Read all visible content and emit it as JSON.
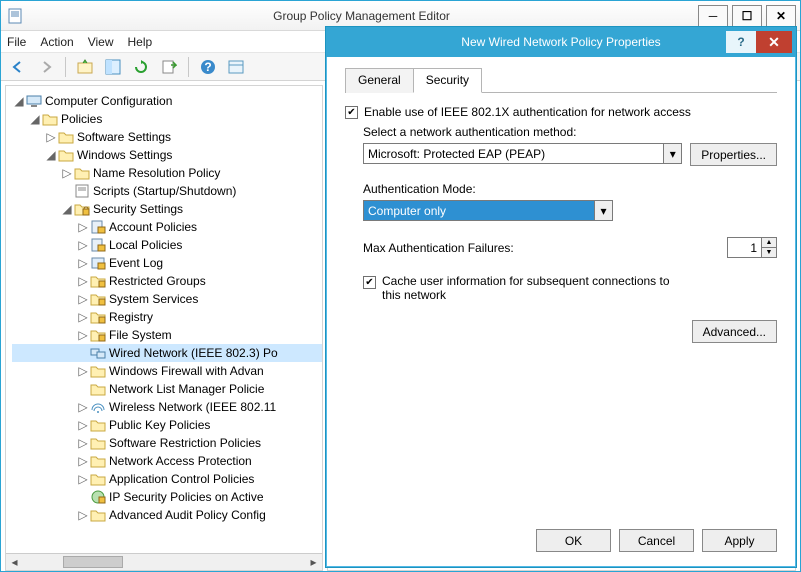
{
  "window": {
    "title": "Group Policy Management Editor"
  },
  "menu": {
    "file": "File",
    "action": "Action",
    "view": "View",
    "help": "Help"
  },
  "tree": {
    "root": "Computer Configuration",
    "policies": "Policies",
    "software": "Software Settings",
    "windows": "Windows Settings",
    "nrp": "Name Resolution Policy",
    "scripts": "Scripts (Startup/Shutdown)",
    "security": "Security Settings",
    "nodes": {
      "account": "Account Policies",
      "local": "Local Policies",
      "eventlog": "Event Log",
      "restricted": "Restricted Groups",
      "system": "System Services",
      "registry": "Registry",
      "file": "File System",
      "wired": "Wired Network (IEEE 802.3) Po",
      "firewall": "Windows Firewall with Advan",
      "nlm": "Network List Manager Policie",
      "wireless": "Wireless Network (IEEE 802.11",
      "pki": "Public Key Policies",
      "srp": "Software Restriction Policies",
      "nap": "Network Access Protection",
      "acp": "Application Control Policies",
      "ipsec": "IP Security Policies on Active",
      "audit": "Advanced Audit Policy Config"
    }
  },
  "dialog": {
    "title": "New Wired Network Policy Properties",
    "tabs": {
      "general": "General",
      "security": "Security"
    },
    "enable_label": "Enable use of IEEE 802.1X authentication for network access",
    "auth_method_label": "Select a network authentication method:",
    "auth_method_value": "Microsoft: Protected EAP (PEAP)",
    "properties_btn": "Properties...",
    "auth_mode_label": "Authentication Mode:",
    "auth_mode_value": "Computer only",
    "max_fail_label": "Max Authentication Failures:",
    "max_fail_value": "1",
    "cache_label": "Cache user information for subsequent connections to this network",
    "advanced_btn": "Advanced...",
    "ok": "OK",
    "cancel": "Cancel",
    "apply": "Apply"
  }
}
